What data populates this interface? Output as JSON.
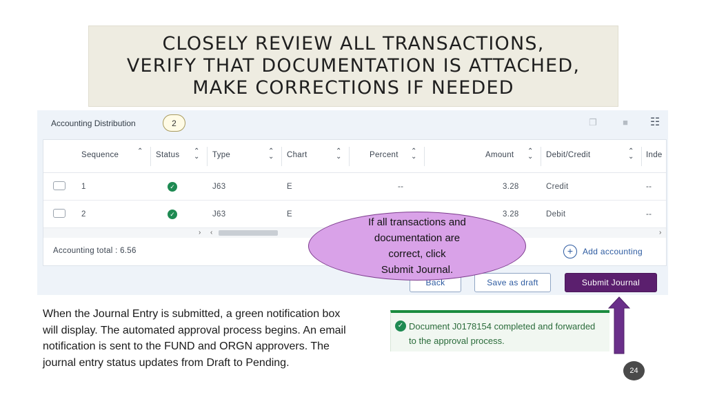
{
  "title_lines": [
    "CLOSELY REVIEW ALL TRANSACTIONS,",
    "VERIFY THAT DOCUMENTATION IS ATTACHED,",
    "MAKE CORRECTIONS IF NEEDED"
  ],
  "panel": {
    "title": "Accounting Distribution",
    "count": "2",
    "toolbar_icons": [
      "copy-icon",
      "delete-icon",
      "columns-icon"
    ]
  },
  "table": {
    "columns": [
      "Sequence",
      "Status",
      "Type",
      "Chart",
      "Percent",
      "Amount",
      "Debit/Credit",
      "Inde"
    ],
    "rows": [
      {
        "sequence": "1",
        "status": "complete",
        "type": "J63",
        "chart": "E",
        "percent": "--",
        "amount": "3.28",
        "debit_credit": "Credit",
        "index": "--"
      },
      {
        "sequence": "2",
        "status": "complete",
        "type": "J63",
        "chart": "E",
        "percent": "",
        "amount": "3.28",
        "debit_credit": "Debit",
        "index": "--"
      }
    ]
  },
  "accounting_total": "Accounting total : 6.56",
  "add_accounting_label": "Add accounting",
  "buttons": {
    "back": "Back",
    "save_draft": "Save as draft",
    "submit": "Submit Journal"
  },
  "callout_lines": [
    "If all transactions and",
    "documentation are",
    "correct, click",
    "Submit Journal."
  ],
  "body_lines": [
    "When the Journal Entry is submitted, a green notification box",
    "will display.  The automated approval process begins.  An email",
    "notification is sent to the FUND and ORGN approvers.  The",
    "journal entry status updates from Draft to Pending."
  ],
  "notification_lines": [
    "Document J0178154 completed and forwarded",
    "to the approval process."
  ],
  "page_number": "24",
  "colors": {
    "accent_purple": "#5b1f6e",
    "arrow_purple": "#6a2f8a",
    "success_green": "#1e8a52",
    "title_bg": "#eeece1",
    "callout_fill": "#d9a2e8"
  }
}
